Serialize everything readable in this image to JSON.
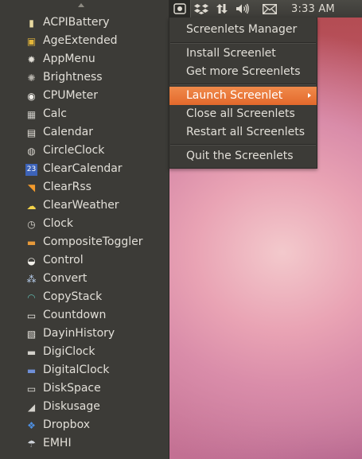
{
  "topbar": {
    "icons": [
      {
        "name": "screenlets-tray-icon",
        "glyph": "◙"
      },
      {
        "name": "dropbox-icon",
        "glyph": "❖"
      },
      {
        "name": "network-arrows-icon",
        "glyph": "⇅"
      },
      {
        "name": "volume-icon",
        "glyph": "🔊"
      },
      {
        "name": "mail-envelope-icon",
        "glyph": "✉"
      }
    ],
    "clock": "3:33 AM"
  },
  "main_menu": {
    "items": [
      {
        "label": "Screenlets Manager"
      },
      {
        "label": "Install Screenlet"
      },
      {
        "label": "Get more Screenlets"
      },
      {
        "label": "Launch Screenlet",
        "highlighted": true,
        "has_submenu": true
      },
      {
        "label": "Close all Screenlets"
      },
      {
        "label": "Restart all Screenlets"
      },
      {
        "label": "Quit the Screenlets"
      }
    ]
  },
  "submenu": {
    "items": [
      {
        "label": "ACPIBattery",
        "icon": "battery-icon",
        "glyph": "▮",
        "color": "#e8d9a0"
      },
      {
        "label": "AgeExtended",
        "icon": "age-icon",
        "glyph": "▣",
        "color": "#e2b53a"
      },
      {
        "label": "AppMenu",
        "icon": "gear-icon",
        "glyph": "✹",
        "color": "#e0ddd5"
      },
      {
        "label": "Brightness",
        "icon": "sun-icon",
        "glyph": "✺",
        "color": "#b8b5ae"
      },
      {
        "label": "CPUMeter",
        "icon": "cpu-meter-icon",
        "glyph": "◉",
        "color": "#f0eee8"
      },
      {
        "label": "Calc",
        "icon": "calculator-icon",
        "glyph": "▦",
        "color": "#c9c7c2"
      },
      {
        "label": "Calendar",
        "icon": "calendar-icon",
        "glyph": "▤",
        "color": "#e6e3dc"
      },
      {
        "label": "CircleClock",
        "icon": "circle-clock-icon",
        "glyph": "◍",
        "color": "#d8d5ce"
      },
      {
        "label": "ClearCalendar",
        "icon": "clear-calendar-icon",
        "glyph": "23",
        "color": "#7fa7e0"
      },
      {
        "label": "ClearRss",
        "icon": "rss-icon",
        "glyph": "◥",
        "color": "#f39a2c"
      },
      {
        "label": "ClearWeather",
        "icon": "weather-icon",
        "glyph": "☁",
        "color": "#f4d34a"
      },
      {
        "label": "Clock",
        "icon": "clock-icon",
        "glyph": "◷",
        "color": "#d9d6cf"
      },
      {
        "label": "CompositeToggler",
        "icon": "composite-toggler-icon",
        "glyph": "▬",
        "color": "#e89a3a"
      },
      {
        "label": "Control",
        "icon": "control-icon",
        "glyph": "◒",
        "color": "#f2f0ea"
      },
      {
        "label": "Convert",
        "icon": "convert-icon",
        "glyph": "⁂",
        "color": "#b9d0ef"
      },
      {
        "label": "CopyStack",
        "icon": "copy-stack-icon",
        "glyph": "◠",
        "color": "#5fb3a8"
      },
      {
        "label": "Countdown",
        "icon": "countdown-icon",
        "glyph": "▭",
        "color": "#efede8"
      },
      {
        "label": "DayinHistory",
        "icon": "day-in-history-icon",
        "glyph": "▧",
        "color": "#e9e7e1"
      },
      {
        "label": "DigiClock",
        "icon": "digi-clock-icon",
        "glyph": "▬",
        "color": "#d3d1cb"
      },
      {
        "label": "DigitalClock",
        "icon": "digital-clock-icon",
        "glyph": "▬",
        "color": "#6f8fd8"
      },
      {
        "label": "DiskSpace",
        "icon": "disk-space-icon",
        "glyph": "▭",
        "color": "#e5e3de"
      },
      {
        "label": "Diskusage",
        "icon": "disk-usage-icon",
        "glyph": "◢",
        "color": "#d4d2cc"
      },
      {
        "label": "Dropbox",
        "icon": "dropbox-app-icon",
        "glyph": "❖",
        "color": "#4e8fe0"
      },
      {
        "label": "EMHI",
        "icon": "emhi-weather-icon",
        "glyph": "☂",
        "color": "#cfd3da"
      }
    ]
  }
}
